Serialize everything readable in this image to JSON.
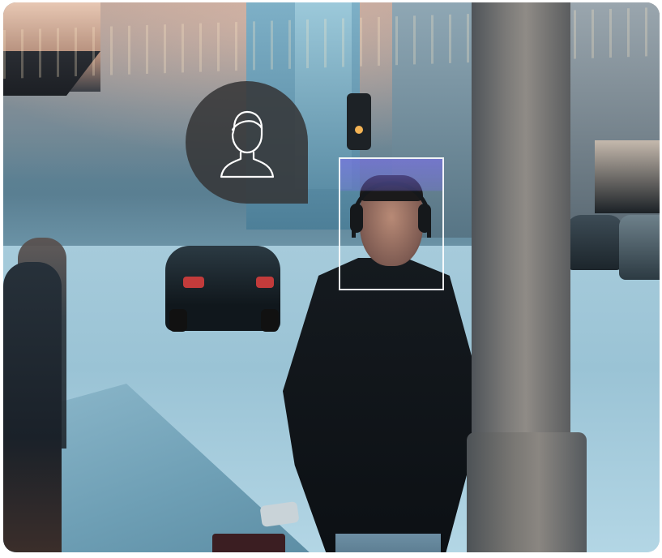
{
  "overlay": {
    "avatar_icon": "user-icon",
    "bubble_color": "#343436",
    "face_box_color": "#ffffff",
    "face_box_fill": "#786ee6"
  }
}
